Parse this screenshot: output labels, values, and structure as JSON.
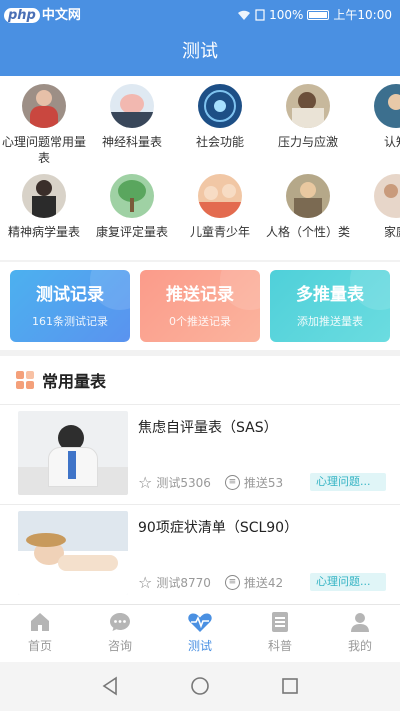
{
  "status": {
    "watermark_php": "php",
    "watermark_text": "中文网",
    "battery": "100%",
    "time": "上午10:00"
  },
  "title": "测试",
  "categories": [
    {
      "label": "心理问题常用量表"
    },
    {
      "label": "神经科量表"
    },
    {
      "label": "社会功能"
    },
    {
      "label": "压力与应激"
    },
    {
      "label": "认知"
    },
    {
      "label": "精神病学量表"
    },
    {
      "label": "康复评定量表"
    },
    {
      "label": "儿童青少年"
    },
    {
      "label": "人格（个性）类"
    },
    {
      "label": "家庭"
    }
  ],
  "cards": [
    {
      "title": "测试记录",
      "sub": "161条测试记录",
      "color_from": "#4cb1ef",
      "color_to": "#5a93ef"
    },
    {
      "title": "推送记录",
      "sub": "0个推送记录",
      "color_from": "#fb9b8a",
      "color_to": "#fbb49e"
    },
    {
      "title": "多推量表",
      "sub": "添加推送量表",
      "color_from": "#4fd0d9",
      "color_to": "#6bdce0"
    }
  ],
  "section_title": "常用量表",
  "scales": [
    {
      "name": "焦虑自评量表（SAS）",
      "tests": "测试5306",
      "pushes": "推送53",
      "tag": "心理问题..."
    },
    {
      "name": "90项症状清单（SCL90）",
      "tests": "测试8770",
      "pushes": "推送42",
      "tag": "心理问题..."
    }
  ],
  "tabs": [
    {
      "label": "首页",
      "icon": "home-icon"
    },
    {
      "label": "咨询",
      "icon": "chat-icon"
    },
    {
      "label": "测试",
      "icon": "heartbeat-icon"
    },
    {
      "label": "科普",
      "icon": "document-icon"
    },
    {
      "label": "我的",
      "icon": "user-icon"
    }
  ],
  "active_tab": "测试",
  "colors": {
    "primary": "#4a90e2",
    "tag_text": "#35b4c4",
    "tag_bg": "#e0f5f7"
  }
}
